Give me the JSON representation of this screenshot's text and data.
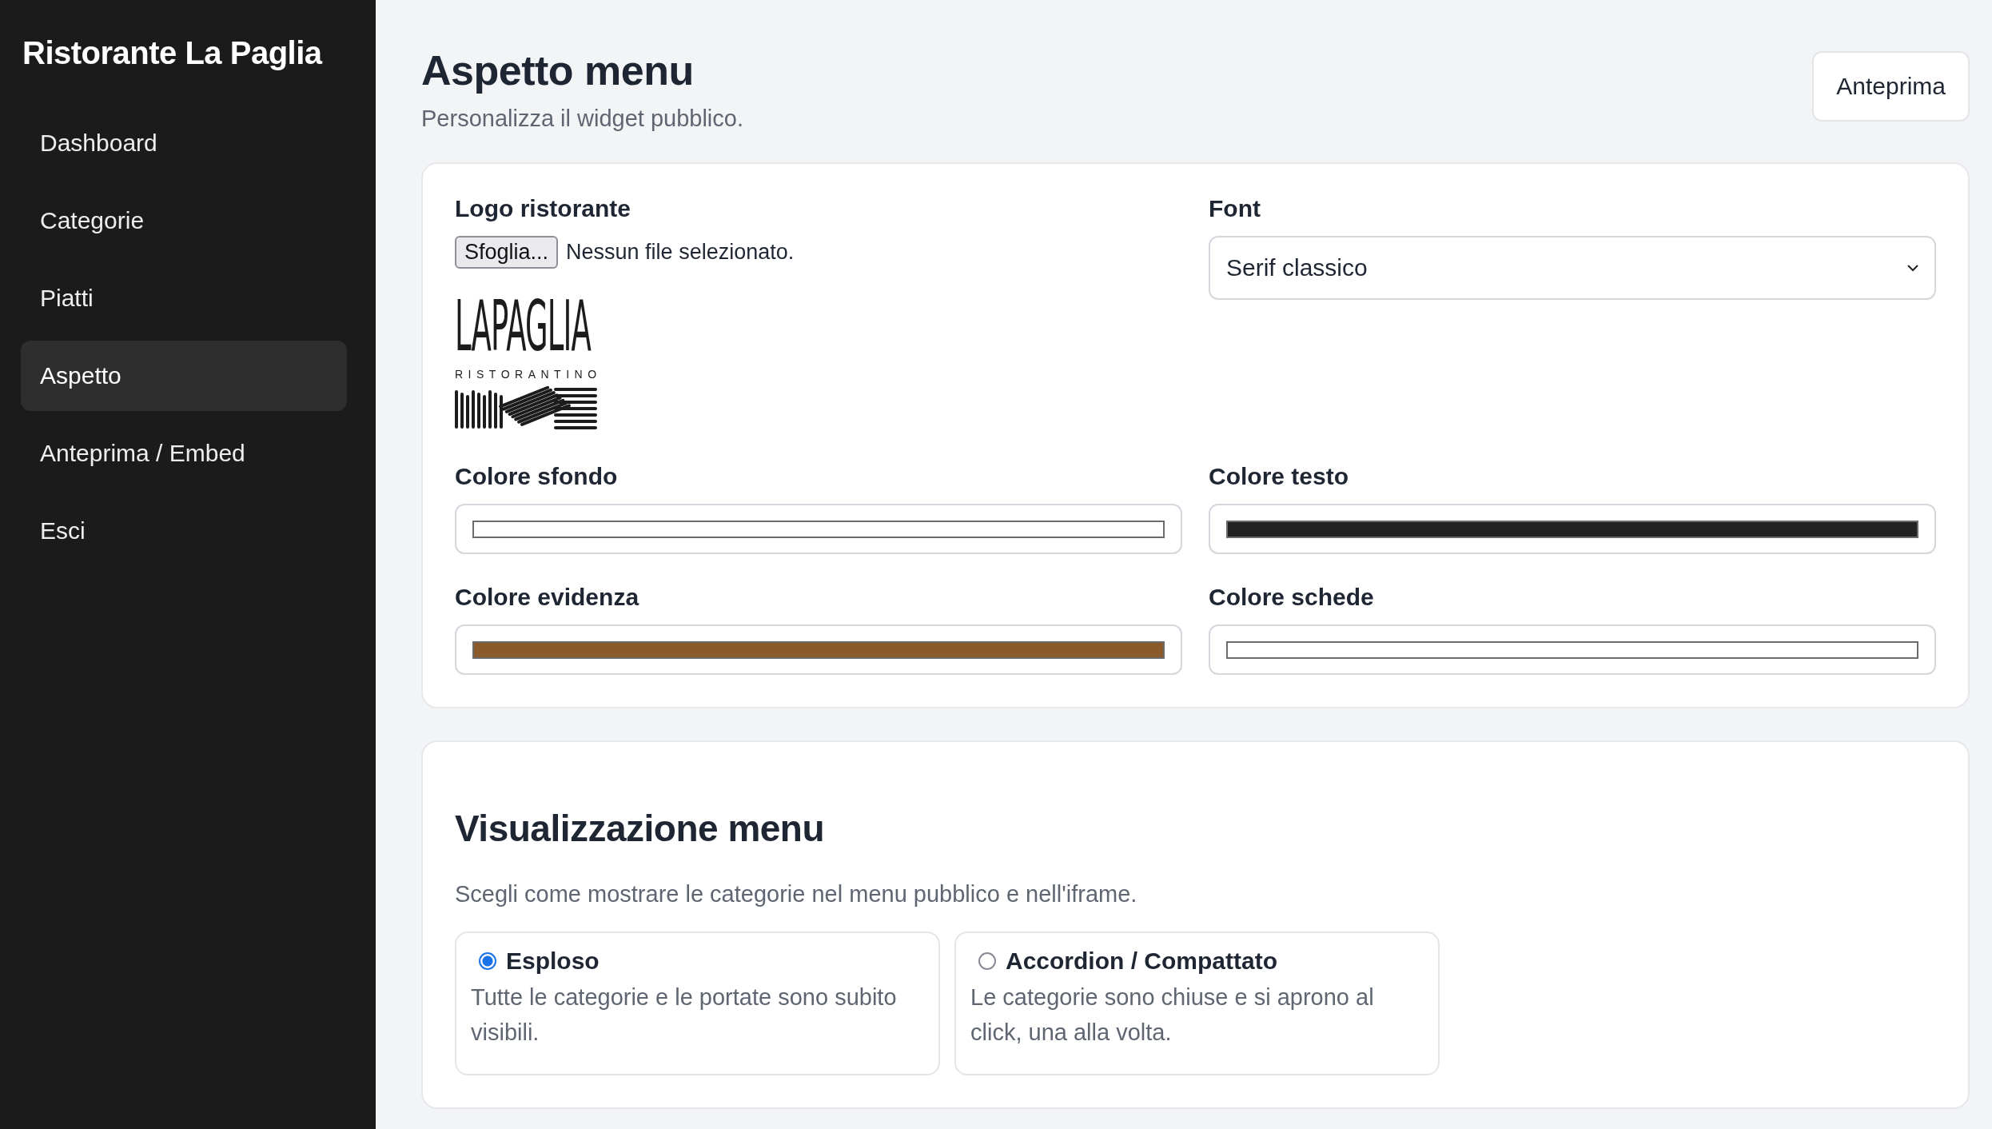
{
  "sidebar": {
    "brand": "Ristorante La Paglia",
    "items": [
      {
        "label": "Dashboard",
        "selected": false
      },
      {
        "label": "Categorie",
        "selected": false
      },
      {
        "label": "Piatti",
        "selected": false
      },
      {
        "label": "Aspetto",
        "selected": true
      },
      {
        "label": "Anteprima / Embed",
        "selected": false
      },
      {
        "label": "Esci",
        "selected": false
      }
    ]
  },
  "header": {
    "title": "Aspetto menu",
    "subtitle": "Personalizza il widget pubblico.",
    "button": "Anteprima"
  },
  "appearance": {
    "logo": {
      "label": "Logo ristorante",
      "file_button": "Sfoglia...",
      "file_status": "Nessun file selezionato.",
      "logo_text": "LAPAGLIA",
      "logo_subtext": "RISTORANTINO"
    },
    "font": {
      "label": "Font",
      "value": "Serif classico"
    },
    "colors": [
      {
        "label": "Colore sfondo",
        "color": "#ffffff"
      },
      {
        "label": "Colore testo",
        "color": "#222222"
      },
      {
        "label": "Colore evidenza",
        "color": "#8b5a2b"
      },
      {
        "label": "Colore schede",
        "color": "#ffffff"
      }
    ]
  },
  "display": {
    "title": "Visualizzazione menu",
    "description": "Scegli come mostrare le categorie nel menu pubblico e nell'iframe.",
    "options": [
      {
        "label": "Esploso",
        "description": "Tutte le categorie e le portate sono subito visibili.",
        "selected": true
      },
      {
        "label": "Accordion / Compattato",
        "description": "Le categorie sono chiuse e si aprono al click, una alla volta.",
        "selected": false
      }
    ]
  }
}
